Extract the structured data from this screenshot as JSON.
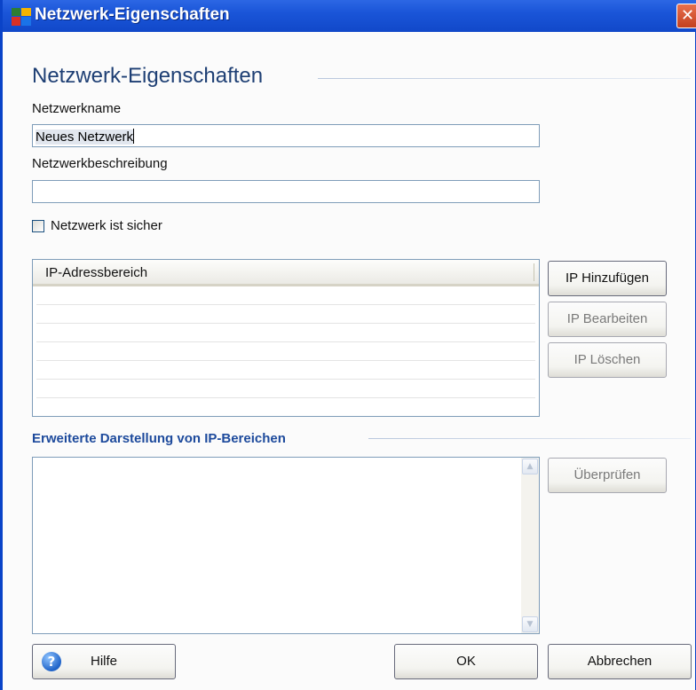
{
  "window": {
    "title": "Netzwerk-Eigenschaften",
    "close_symbol": "✕",
    "icons": {
      "app": "avg-app-icon",
      "close": "close-icon"
    }
  },
  "heading": "Netzwerk-Eigenschaften",
  "fields": {
    "name_label": "Netzwerkname",
    "name_value": "Neues Netzwerk",
    "description_label": "Netzwerkbeschreibung",
    "description_value": ""
  },
  "checkbox": {
    "label": "Netzwerk ist sicher",
    "checked": false
  },
  "ip_list": {
    "column_header": "IP-Adressbereich",
    "rows": []
  },
  "ip_buttons": {
    "add": "IP Hinzufügen",
    "edit": "IP Bearbeiten",
    "delete": "IP Löschen"
  },
  "extended": {
    "heading": "Erweiterte Darstellung von IP-Bereichen",
    "text": "",
    "check_button": "Überprüfen",
    "scroll_up": "▲",
    "scroll_down": "▼"
  },
  "footer": {
    "help_icon": "?",
    "help": "Hilfe",
    "ok": "OK",
    "cancel": "Abbrechen"
  },
  "colors": {
    "titlebar": "#1a55d8",
    "heading": "#1e3f74",
    "section_heading": "#1d4a9c"
  }
}
